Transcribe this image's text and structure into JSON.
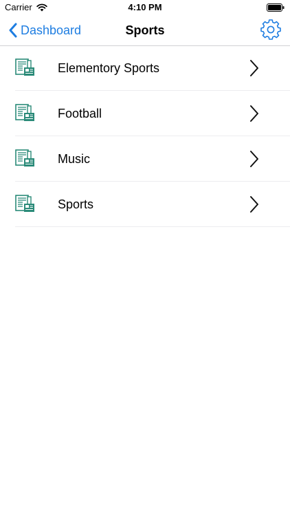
{
  "status_bar": {
    "carrier": "Carrier",
    "time": "4:10 PM",
    "wifi_icon": "wifi-icon",
    "battery_icon": "battery-icon"
  },
  "nav": {
    "back_label": "Dashboard",
    "back_icon": "chevron-left-icon",
    "title": "Sports",
    "settings_icon": "gear-icon"
  },
  "items": [
    {
      "label": "Elementory Sports",
      "icon": "newspaper-icon"
    },
    {
      "label": "Football",
      "icon": "newspaper-icon"
    },
    {
      "label": "Music",
      "icon": "newspaper-icon"
    },
    {
      "label": "Sports",
      "icon": "newspaper-icon"
    }
  ],
  "colors": {
    "accent": "#1e7de1",
    "icon_teal": "#2a8a78",
    "separator": "#ececef"
  }
}
